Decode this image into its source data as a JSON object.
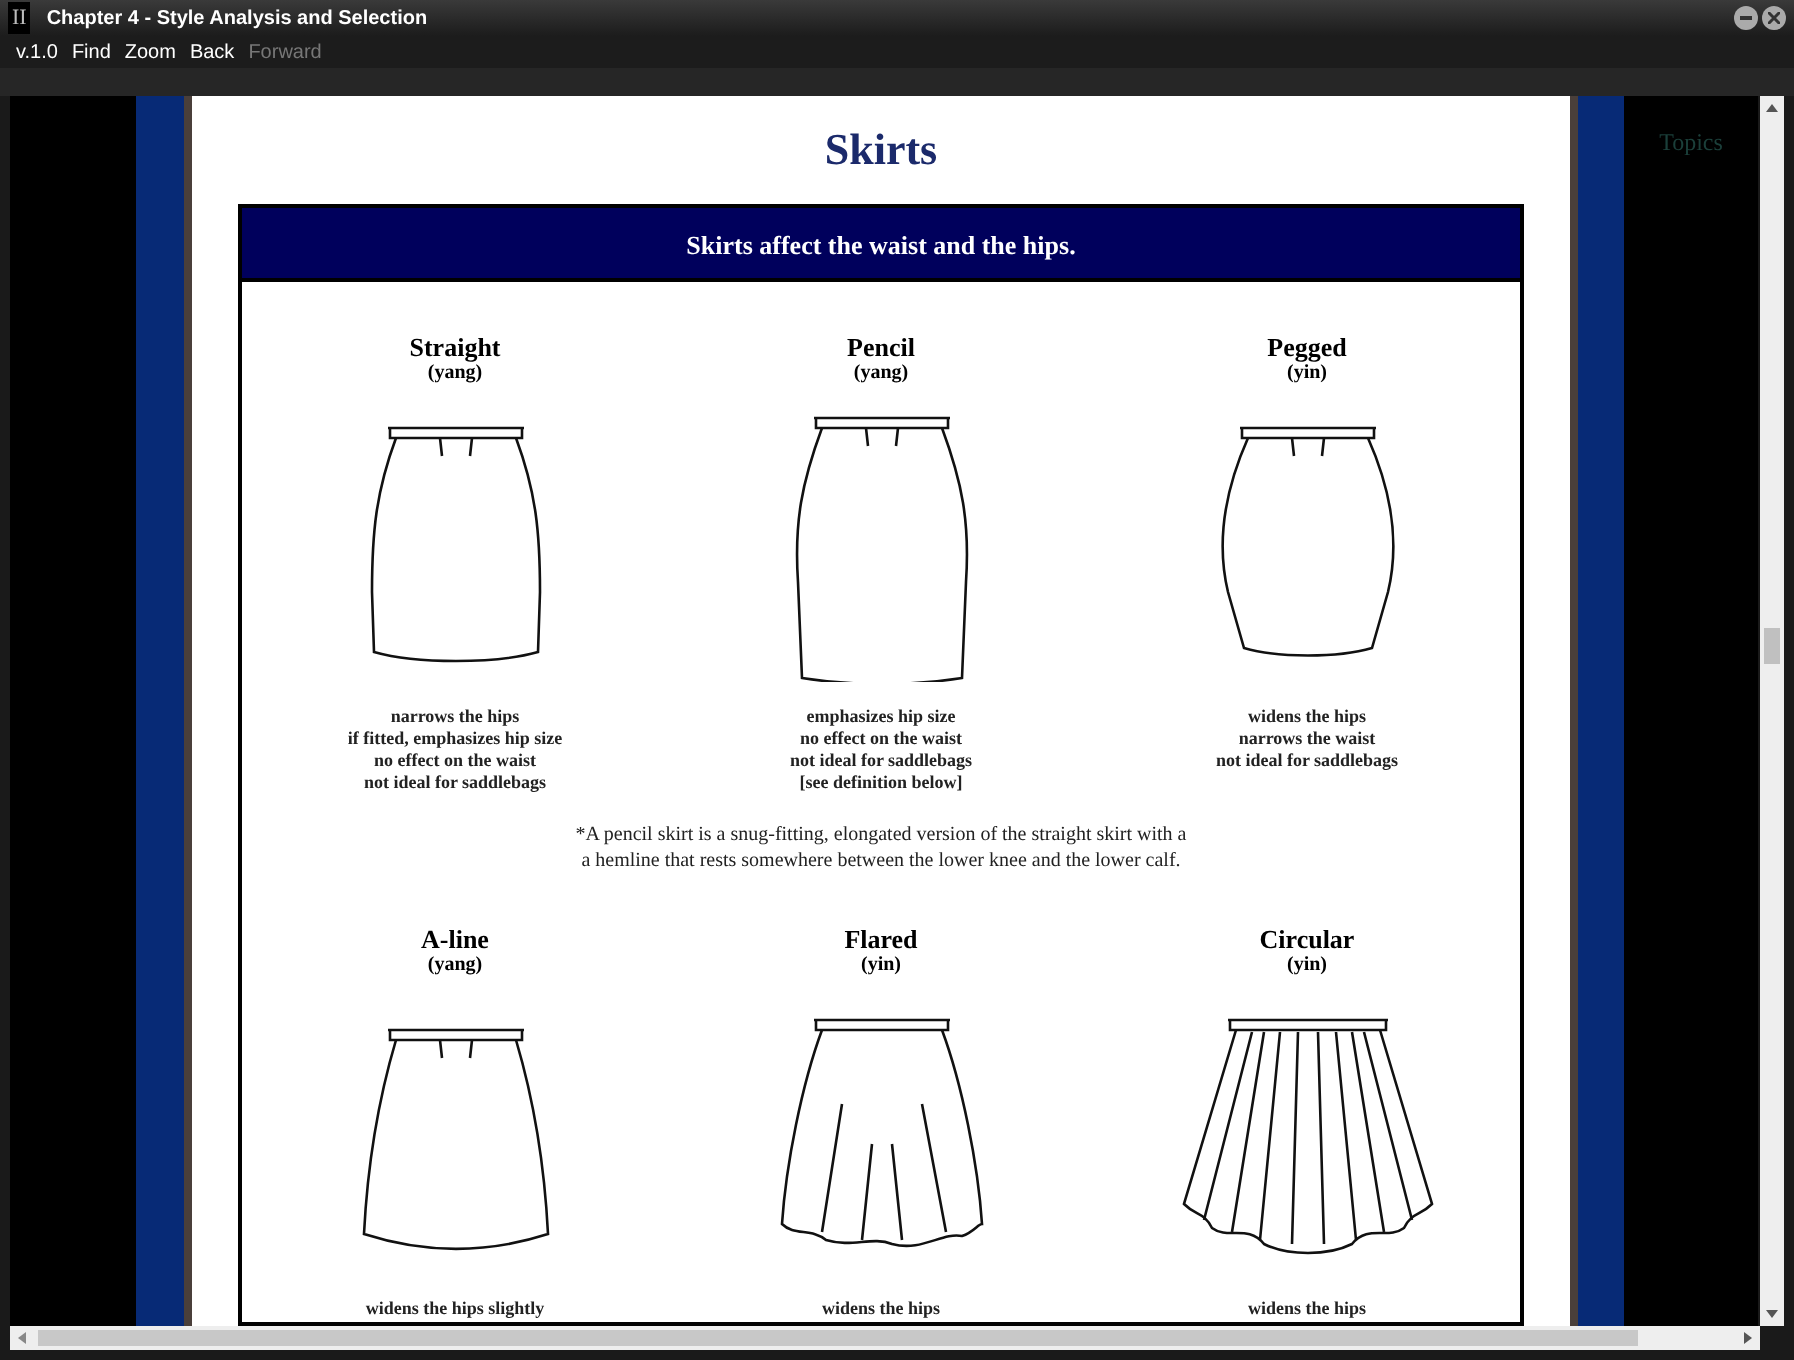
{
  "window": {
    "title": "Chapter 4 - Style Analysis and Selection",
    "app_mark": "II"
  },
  "menu": [
    {
      "label": "v.1.0",
      "disabled": false
    },
    {
      "label": "Find",
      "disabled": false
    },
    {
      "label": "Zoom",
      "disabled": false
    },
    {
      "label": "Back",
      "disabled": false
    },
    {
      "label": "Forward",
      "disabled": true
    }
  ],
  "side_panel": {
    "title": "Topics"
  },
  "page": {
    "title": "Skirts",
    "banner": "Skirts affect the waist and the hips.",
    "rows": [
      {
        "skirts": [
          {
            "name": "Straight",
            "type": "(yang)",
            "kind": "straight",
            "notes": [
              "narrows the hips",
              "if fitted, emphasizes hip size",
              "no effect on the waist",
              "not ideal for saddlebags"
            ]
          },
          {
            "name": "Pencil",
            "type": "(yang)",
            "kind": "pencil",
            "notes": [
              "emphasizes hip size",
              "no effect on the waist",
              "not ideal for saddlebags",
              "[see definition below]"
            ]
          },
          {
            "name": "Pegged",
            "type": "(yin)",
            "kind": "pegged",
            "notes": [
              "widens the hips",
              "narrows the waist",
              "not ideal for saddlebags"
            ]
          }
        ],
        "footnote": [
          "*A pencil skirt is a snug-fitting, elongated version of the straight skirt with a",
          "a hemline that rests somewhere between the lower knee and the lower calf."
        ]
      },
      {
        "skirts": [
          {
            "name": "A-line",
            "type": "(yang)",
            "kind": "aline",
            "notes": [
              "widens the hips slightly"
            ]
          },
          {
            "name": "Flared",
            "type": "(yin)",
            "kind": "flared",
            "notes": [
              "widens the hips"
            ]
          },
          {
            "name": "Circular",
            "type": "(yin)",
            "kind": "circular",
            "notes": [
              "widens the hips"
            ]
          }
        ]
      }
    ]
  }
}
